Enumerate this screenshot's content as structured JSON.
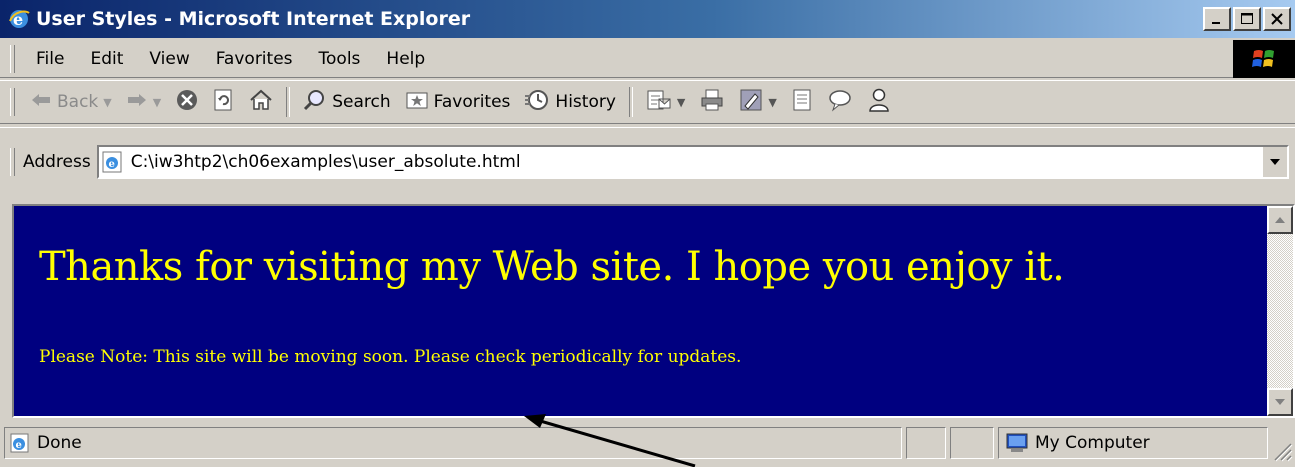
{
  "window": {
    "title": "User Styles - Microsoft Internet Explorer",
    "controls": {
      "minimize": "_",
      "maximize": "□",
      "close": "×"
    }
  },
  "menu": {
    "items": [
      {
        "label": "File"
      },
      {
        "label": "Edit"
      },
      {
        "label": "View"
      },
      {
        "label": "Favorites"
      },
      {
        "label": "Tools"
      },
      {
        "label": "Help"
      }
    ]
  },
  "toolbar": {
    "back_label": "Back",
    "search_label": "Search",
    "favorites_label": "Favorites",
    "history_label": "History"
  },
  "address": {
    "label": "Address",
    "url": "C:\\iw3htp2\\ch06examples\\user_absolute.html"
  },
  "page": {
    "heading": "Thanks for visiting my Web site. I hope you enjoy it.",
    "note": "Please Note: This site will be moving soon. Please check periodically for updates.",
    "background_color": "#000080",
    "text_color": "#ffff00"
  },
  "status": {
    "text": "Done",
    "zone": "My Computer"
  },
  "colors": {
    "titlebar_start": "#0a246a",
    "titlebar_end": "#a6caf0",
    "chrome": "#d4d0c8"
  }
}
